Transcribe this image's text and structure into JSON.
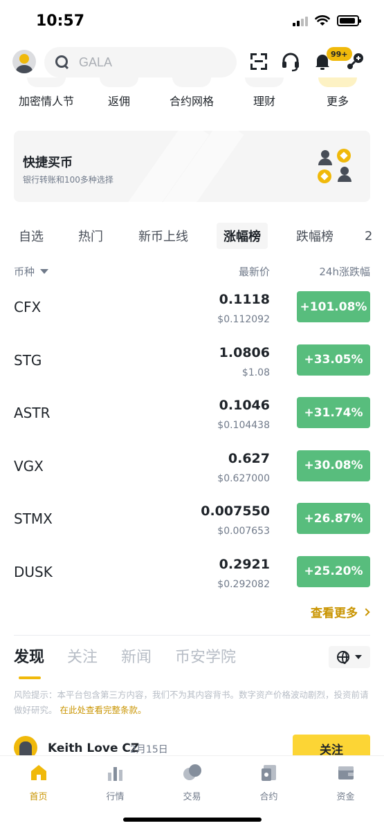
{
  "status_bar": {
    "time": "10:57"
  },
  "header": {
    "search_placeholder": "GALA",
    "notification_badge": "99+"
  },
  "shortcuts": [
    {
      "label": "加密情人节"
    },
    {
      "label": "返佣"
    },
    {
      "label": "合约网格"
    },
    {
      "label": "理财"
    },
    {
      "label": "更多"
    }
  ],
  "quick_buy": {
    "title": "快捷买币",
    "subtitle": "银行转账和100多种选择"
  },
  "market_tabs": [
    {
      "label": "自选"
    },
    {
      "label": "热门"
    },
    {
      "label": "新币上线"
    },
    {
      "label": "涨幅榜",
      "active": true
    },
    {
      "label": "跌幅榜"
    },
    {
      "label": "2"
    }
  ],
  "columns": {
    "coin": "币种",
    "price": "最新价",
    "change": "24h涨跌幅"
  },
  "rows": [
    {
      "symbol": "CFX",
      "price": "0.1118",
      "fiat": "$0.112092",
      "change": "+101.08%"
    },
    {
      "symbol": "STG",
      "price": "1.0806",
      "fiat": "$1.08",
      "change": "+33.05%"
    },
    {
      "symbol": "ASTR",
      "price": "0.1046",
      "fiat": "$0.104438",
      "change": "+31.74%"
    },
    {
      "symbol": "VGX",
      "price": "0.627",
      "fiat": "$0.627000",
      "change": "+30.08%"
    },
    {
      "symbol": "STMX",
      "price": "0.007550",
      "fiat": "$0.007653",
      "change": "+26.87%"
    },
    {
      "symbol": "DUSK",
      "price": "0.2921",
      "fiat": "$0.292082",
      "change": "+25.20%"
    }
  ],
  "see_more": "查看更多",
  "feed_tabs": [
    {
      "label": "发现",
      "active": true
    },
    {
      "label": "关注"
    },
    {
      "label": "新闻"
    },
    {
      "label": "币安学院"
    }
  ],
  "risk_notice": {
    "text": "风险提示：本平台包含第三方内容，我们不为其内容背书。数字资产价格波动剧烈，投资前请做好研究。",
    "link": "在此处查看完整条款。"
  },
  "post": {
    "author": "Keith Love CZ",
    "date": "2月15日",
    "follow_label": "关注"
  },
  "bottom_nav": [
    {
      "label": "首页",
      "icon": "home-icon",
      "active": true
    },
    {
      "label": "行情",
      "icon": "markets-icon"
    },
    {
      "label": "交易",
      "icon": "trade-icon"
    },
    {
      "label": "合约",
      "icon": "futures-icon"
    },
    {
      "label": "资金",
      "icon": "wallet-icon"
    }
  ],
  "colors": {
    "accent": "#f0b90b",
    "accent_text": "#c99400",
    "up_green": "#58bd7d",
    "follow_button": "#fcd535"
  }
}
